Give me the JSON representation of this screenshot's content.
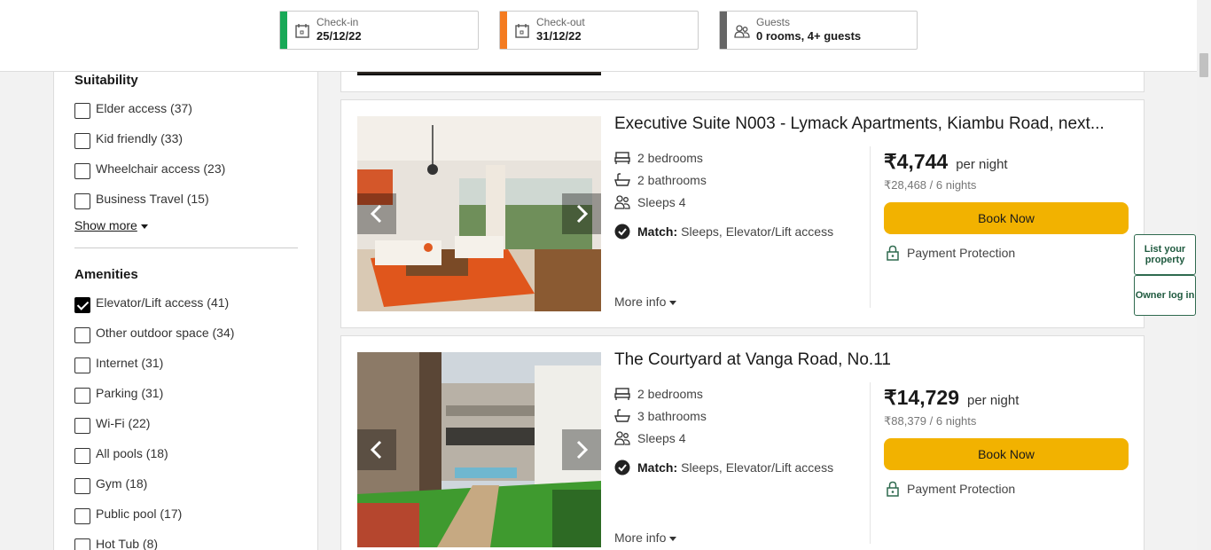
{
  "header": {
    "checkin": {
      "label": "Check-in",
      "value": "25/12/22",
      "color": "#18a957"
    },
    "checkout": {
      "label": "Check-out",
      "value": "31/12/22",
      "color": "#f47b20"
    },
    "guests": {
      "label": "Guests",
      "value": "0 rooms, 4+ guests",
      "color": "#666666"
    }
  },
  "sidebar": {
    "suitability": {
      "heading": "Suitability",
      "items": [
        {
          "label": "Elder access (37)",
          "checked": false
        },
        {
          "label": "Kid friendly (33)",
          "checked": false
        },
        {
          "label": "Wheelchair access (23)",
          "checked": false
        },
        {
          "label": "Business Travel (15)",
          "checked": false
        }
      ],
      "show_more": "Show more"
    },
    "amenities": {
      "heading": "Amenities",
      "items": [
        {
          "label": "Elevator/Lift access (41)",
          "checked": true
        },
        {
          "label": "Other outdoor space (34)",
          "checked": false
        },
        {
          "label": "Internet (31)",
          "checked": false
        },
        {
          "label": "Parking (31)",
          "checked": false
        },
        {
          "label": "Wi-Fi (22)",
          "checked": false
        },
        {
          "label": "All pools (18)",
          "checked": false
        },
        {
          "label": "Gym (18)",
          "checked": false
        },
        {
          "label": "Public pool (17)",
          "checked": false
        },
        {
          "label": "Hot Tub (8)",
          "checked": false
        }
      ]
    }
  },
  "listings": [
    {
      "title": "Executive Suite N003 - Lymack Apartments, Kiambu Road, next...",
      "bedrooms": "2 bedrooms",
      "bathrooms": "2 bathrooms",
      "sleeps": "Sleeps 4",
      "match_label": "Match:",
      "match_value": "Sleeps, Elevator/Lift access",
      "more_info": "More info",
      "price": "₹4,744",
      "per_night": "per night",
      "total": "₹28,468 / 6 nights",
      "book": "Book Now",
      "protection": "Payment Protection"
    },
    {
      "title": "The Courtyard at Vanga Road, No.11",
      "bedrooms": "2 bedrooms",
      "bathrooms": "3 bathrooms",
      "sleeps": "Sleeps 4",
      "match_label": "Match:",
      "match_value": "Sleeps, Elevator/Lift access",
      "more_info": "More info",
      "price": "₹14,729",
      "per_night": "per night",
      "total": "₹88,379 / 6 nights",
      "book": "Book Now",
      "protection": "Payment Protection"
    }
  ],
  "side_buttons": {
    "list_property": "List your property",
    "owner_login": "Owner log in"
  },
  "colors": {
    "book_button": "#f2b200",
    "side_button_border": "#2f6a4f"
  }
}
